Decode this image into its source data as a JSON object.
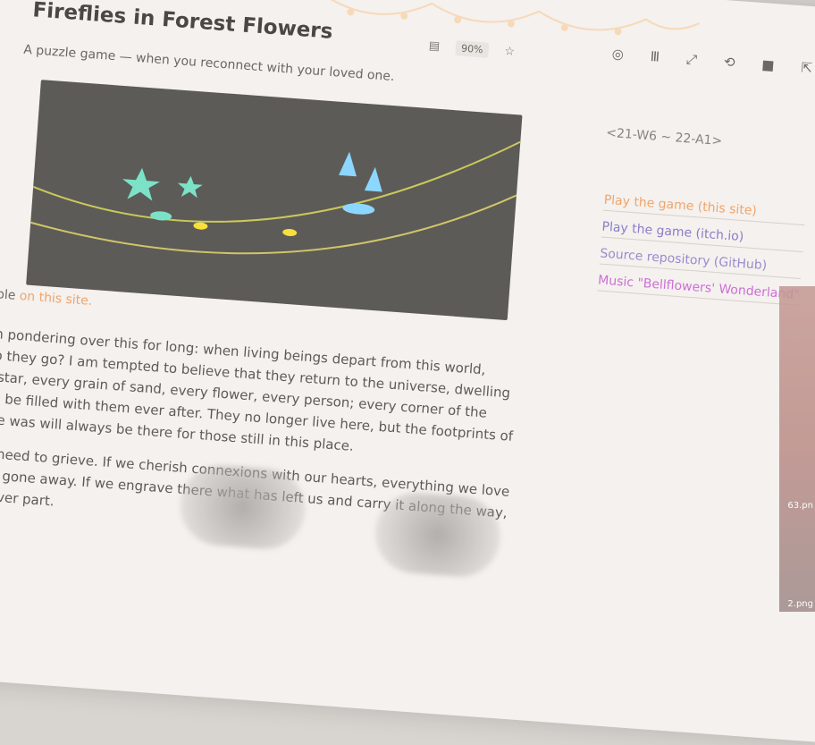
{
  "page": {
    "title": "Fireflies in Forest Flowers",
    "subtitle": "A puzzle game — when you reconnect with your loved one.",
    "meta": "<21-W6 ~ 22-A1>",
    "playable_prefix": "Playable",
    "playable_link": "on this site."
  },
  "toolbar": {
    "zoom": "90%"
  },
  "links": [
    "Play the game (this site)",
    "Play the game (itch.io)",
    "Source repository (GitHub)",
    "Music \"Bellflowers' Wonderland\""
  ],
  "paragraphs": [
    "I've been pondering over this for long: when living beings depart from this world, where do they go? I am tempted to believe that they return to the universe, dwelling in every star, every grain of sand, every flower, every person; every corner of the world will be filled with them ever after. They no longer live here, but the footprints of what once was will always be there for those still in this place.",
    "We don't need to grieve. If we cherish connexions with our hearts, everything we love has never gone away. If we engrave there what has left us and carry it along the way, we will never part."
  ],
  "colors": {
    "accent_orange": "#f2a46a",
    "link_purple": "#8b7dc8",
    "link_magenta": "#cc6fd6"
  }
}
